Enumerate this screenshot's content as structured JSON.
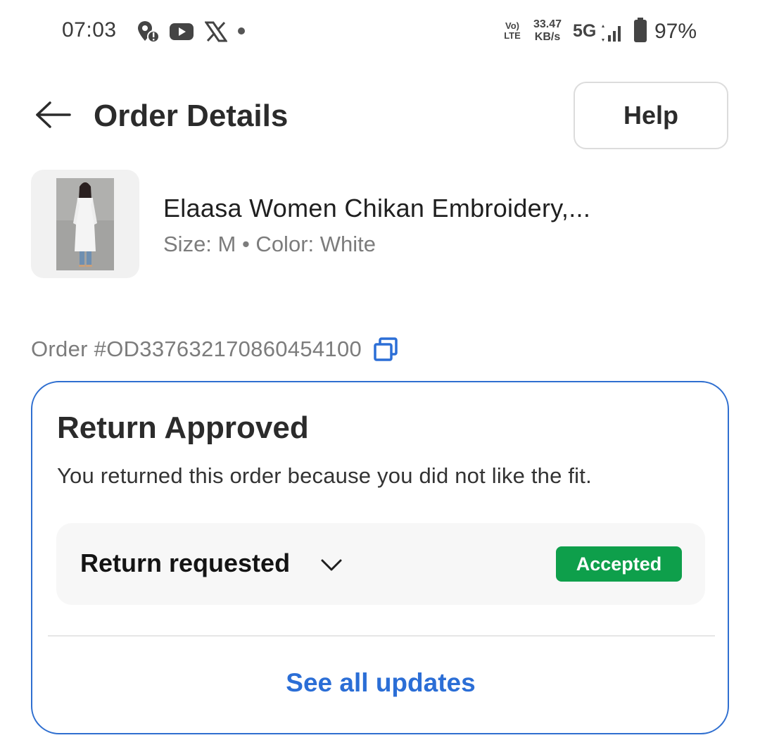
{
  "status_bar": {
    "time": "07:03",
    "notification_icons": [
      "location-alert-icon",
      "youtube-icon",
      "x-icon",
      "dot-icon"
    ],
    "network_type": "VoLTE",
    "network_label_top": "Vo)",
    "network_label_bottom": "LTE",
    "speed_value": "33.47",
    "speed_unit": "KB/s",
    "cell_type": "5G",
    "battery_percent": "97%"
  },
  "header": {
    "title": "Order Details",
    "help_label": "Help",
    "back_icon": "arrow-left-icon"
  },
  "product": {
    "name": "Elaasa Women Chikan Embroidery,...",
    "meta": "Size: M • Color: White"
  },
  "order": {
    "id_text": "Order #OD337632170860454100",
    "copy_icon": "copy-icon"
  },
  "return_card": {
    "title": "Return Approved",
    "description": "You returned this order because you did not like the fit.",
    "status_label": "Return requested",
    "status_badge": "Accepted",
    "see_all_label": "See all updates"
  },
  "colors": {
    "accent_blue": "#2b6ed6",
    "card_border": "#2f6fd0",
    "badge_green": "#0e9f4b",
    "muted_text": "#7c7c7c"
  }
}
